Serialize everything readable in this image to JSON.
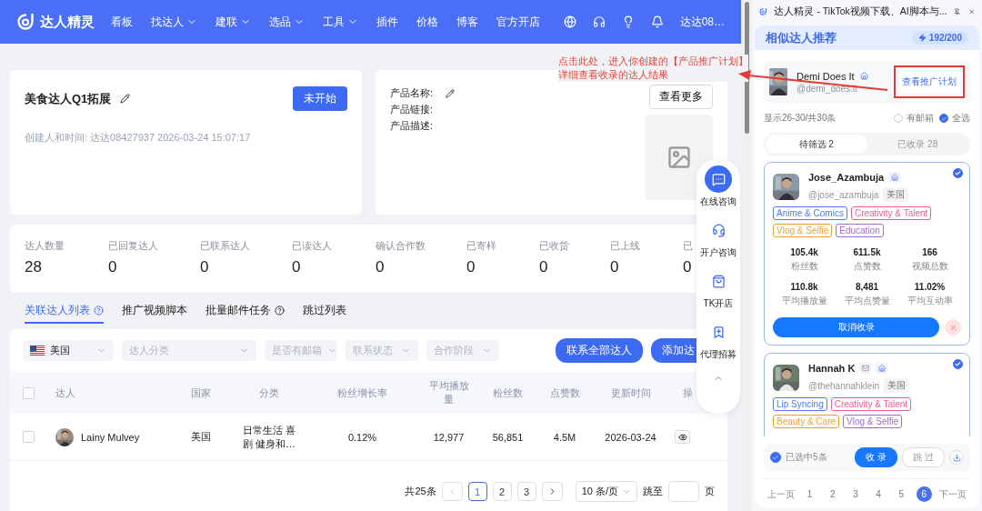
{
  "nav": {
    "logo": "达人精灵",
    "items": [
      {
        "label": "看板",
        "dropdown": false
      },
      {
        "label": "找达人",
        "dropdown": true
      },
      {
        "label": "建联",
        "dropdown": true
      },
      {
        "label": "选品",
        "dropdown": true
      },
      {
        "label": "工具",
        "dropdown": true
      },
      {
        "label": "插件",
        "dropdown": false
      },
      {
        "label": "价格",
        "dropdown": false
      },
      {
        "label": "博客",
        "dropdown": false
      },
      {
        "label": "官方开店",
        "dropdown": false
      }
    ],
    "user": "达达08…"
  },
  "annotation": {
    "lines": [
      "点击此处，进入你创建的【产品推广计划】",
      "详细查看收录的达人结果"
    ]
  },
  "plan_card": {
    "title": "美食达人Q1拓展",
    "status_button": "未开始",
    "meta": "创建人和时间: 达达08427937 2026-03-24 15:07:17"
  },
  "product_card": {
    "fields": [
      "产品名称:",
      "产品链接:",
      "产品描述:"
    ],
    "more_button": "查看更多"
  },
  "stats": [
    {
      "label": "达人数量",
      "value": "28"
    },
    {
      "label": "已回复达人",
      "value": "0"
    },
    {
      "label": "已联系达人",
      "value": "0"
    },
    {
      "label": "已读达人",
      "value": "0"
    },
    {
      "label": "确认合作数",
      "value": "0"
    },
    {
      "label": "已寄样",
      "value": "0"
    },
    {
      "label": "已收货",
      "value": "0"
    },
    {
      "label": "已上线",
      "value": "0"
    },
    {
      "label": "已",
      "value": "0"
    }
  ],
  "tabs": [
    {
      "label": "关联达人列表",
      "selected": true,
      "help": true
    },
    {
      "label": "推广视频脚本",
      "selected": false,
      "help": false
    },
    {
      "label": "批量邮件任务",
      "selected": false,
      "help": true
    },
    {
      "label": "跳过列表",
      "selected": false,
      "help": false
    }
  ],
  "filters": [
    {
      "kind": "country",
      "value": "美国"
    },
    {
      "kind": "select",
      "placeholder": "达人分类"
    },
    {
      "kind": "select",
      "placeholder": "是否有邮箱"
    },
    {
      "kind": "select",
      "placeholder": "联系状态"
    },
    {
      "kind": "select",
      "placeholder": "合作阶段"
    }
  ],
  "actions": [
    "联系全部达人",
    "添加达"
  ],
  "table": {
    "select_all": false,
    "columns": [
      "达人",
      "国家",
      "分类",
      "粉丝增长率",
      "平均播放量",
      "粉丝数",
      "点赞数",
      "更新时间",
      "操"
    ],
    "rows": [
      {
        "checked": false,
        "name": "Lainy Mulvey",
        "country": "美国",
        "category": "日常生活 喜剧 健身和…",
        "growth": "0.12%",
        "avg_views": "12,977",
        "followers": "56,851",
        "likes": "4.5M",
        "updated": "2026-03-24"
      }
    ]
  },
  "pagination": {
    "total": "共25条",
    "pages": [
      {
        "label": "1",
        "selected": true
      },
      {
        "label": "2",
        "selected": false
      },
      {
        "label": "3",
        "selected": false
      }
    ],
    "page_size": "10 条/页",
    "jump_label": "跳至",
    "unit": "页"
  },
  "float_rail": [
    {
      "kind": "chat",
      "label": "在线咨询",
      "selected": true
    },
    {
      "kind": "headset",
      "label": "开户咨询",
      "selected": false
    },
    {
      "kind": "bag",
      "label": "TK开店",
      "selected": false
    },
    {
      "kind": "bookmark",
      "label": "代理招募",
      "selected": false
    },
    {
      "kind": "up"
    }
  ],
  "side_panel": {
    "window_title": "达人精灵 - TikTok视频下载、AI脚本与...",
    "header": "相似达人推荐",
    "quota": "192/200",
    "profile": {
      "name": "Demi Does It",
      "handle": "@demi_does.it",
      "button": "查看推广计划"
    },
    "range": "显示26-30/共30条",
    "options": [
      {
        "label": "有邮箱",
        "checked": false
      },
      {
        "label": "全选",
        "checked": true
      }
    ],
    "tabs": [
      {
        "label": "待筛选 2",
        "selected": true
      },
      {
        "label": "已收录 28",
        "selected": false
      }
    ],
    "creators": [
      {
        "name": "Jose_Azambuja",
        "email": false,
        "handle": "@jose_azambuja",
        "country": "美国",
        "checked": true,
        "tags": [
          {
            "label": "Anime & Comics",
            "color": "#4a7cf0"
          },
          {
            "label": "Creativity & Talent",
            "color": "#ef5b93"
          },
          {
            "label": "Vlog & Selfie",
            "color": "#f0a030"
          },
          {
            "label": "Education",
            "color": "#9b6bd6"
          }
        ],
        "stats": [
          {
            "value": "105.4k",
            "label": "粉丝数"
          },
          {
            "value": "611.5k",
            "label": "点赞数"
          },
          {
            "value": "166",
            "label": "视频总数"
          },
          {
            "value": "110.8k",
            "label": "平均播放量"
          },
          {
            "value": "8,481",
            "label": "平均点赞量"
          },
          {
            "value": "11.02%",
            "label": "平均互动率"
          }
        ],
        "button": "取消收录"
      },
      {
        "name": "Hannah K",
        "email": true,
        "handle": "@thehannahklein",
        "country": "美国",
        "checked": true,
        "tags": [
          {
            "label": "Lip Syncing",
            "color": "#4a7cf0"
          },
          {
            "label": "Creativity & Talent",
            "color": "#ef5b93"
          },
          {
            "label": "Beauty & Care",
            "color": "#f0a030"
          },
          {
            "label": "Vlog & Selfie",
            "color": "#9b6bd6"
          }
        ]
      }
    ],
    "bulk": {
      "checked": true,
      "label": "已选中5条",
      "collect": "收 录",
      "skip": "跳 过"
    },
    "pager": {
      "prev": "上一页",
      "next": "下一页",
      "pages": [
        {
          "label": "1",
          "selected": false
        },
        {
          "label": "2",
          "selected": false
        },
        {
          "label": "3",
          "selected": false
        },
        {
          "label": "4",
          "selected": false
        },
        {
          "label": "5",
          "selected": false
        },
        {
          "label": "6",
          "selected": true
        }
      ]
    }
  }
}
